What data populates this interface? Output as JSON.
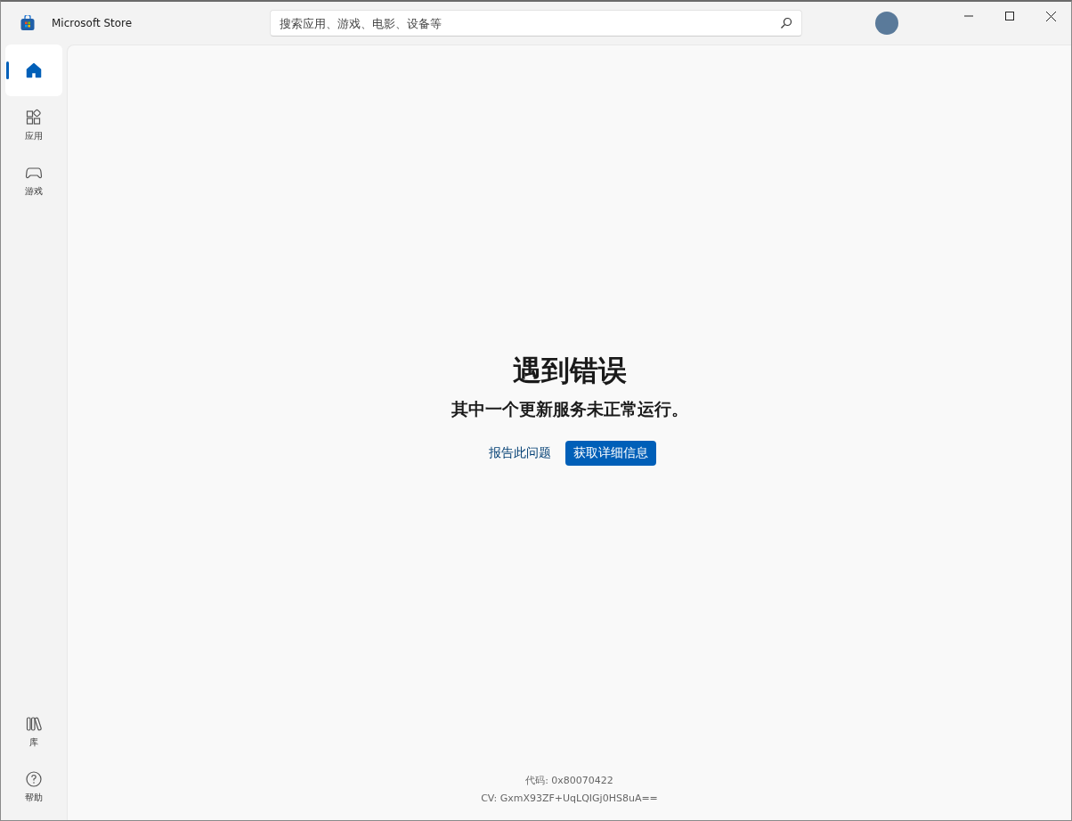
{
  "window": {
    "title": "Microsoft Store"
  },
  "search": {
    "placeholder": "搜索应用、游戏、电影、设备等"
  },
  "nav": {
    "top": [
      {
        "selected": true
      },
      {
        "label": "应用",
        "selected": false
      },
      {
        "label": "游戏",
        "selected": false
      }
    ],
    "bottom": [
      {
        "label": "库",
        "selected": false
      },
      {
        "label": "帮助",
        "selected": false
      }
    ]
  },
  "error": {
    "title": "遇到错误",
    "message": "其中一个更新服务未正常运行。",
    "link": "报告此问题",
    "button": "获取详细信息",
    "code": "代码: 0x80070422",
    "cv": "CV: GxmX93ZF+UqLQIGj0HS8uA=="
  }
}
